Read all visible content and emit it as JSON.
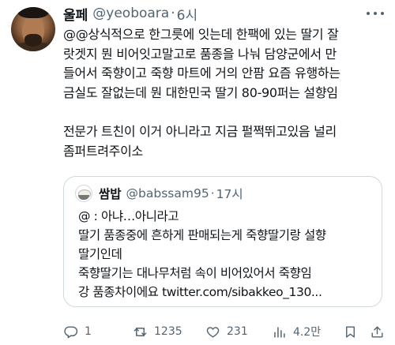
{
  "tweet": {
    "author_name": "울페",
    "author_handle": "@yeoboara",
    "separator": "·",
    "time": "6시",
    "text_lines": [
      "@@상식적으로 한그릇에 잇는데 한팩에 있는 딸기 잘",
      "랏겟지 뭔 비어잇고말고로 품종을 나눠 담양군에서 만",
      "들어서 죽향이고 죽향 마트에 거의 안팜 요즘 유행하는",
      "금실도 잘없는데 뭔 대한민국 딸기 80-90퍼는 설향임",
      "",
      "전문가 트친이 이거 아니라고 지금 펄쩍뛰고있음 널리",
      "좀퍼트려주이소"
    ]
  },
  "quote": {
    "author_name": "쌈밥",
    "author_handle": "@babssam95",
    "separator": "·",
    "time": "17시",
    "text_lines": [
      "@ : 아냐…아니라고",
      "딸기 품종중에 흔하게 판매되는게 죽향딸기랑 설향",
      "딸기인데",
      "죽향딸기는 대나무처럼 속이 비어있어서 죽향임",
      "강 품종차이에요 twitter.com/sibakkeo_130..."
    ]
  },
  "actions": {
    "replies": "1",
    "retweets": "1235",
    "likes": "231",
    "views": "4.2만"
  },
  "icons": {
    "reply": "reply-icon",
    "retweet": "retweet-icon",
    "like": "heart-icon",
    "views": "views-chart-icon",
    "more": "more-options-icon"
  },
  "colors": {
    "text": "#0f1419",
    "secondary": "#536471",
    "border": "#cfd9de"
  }
}
